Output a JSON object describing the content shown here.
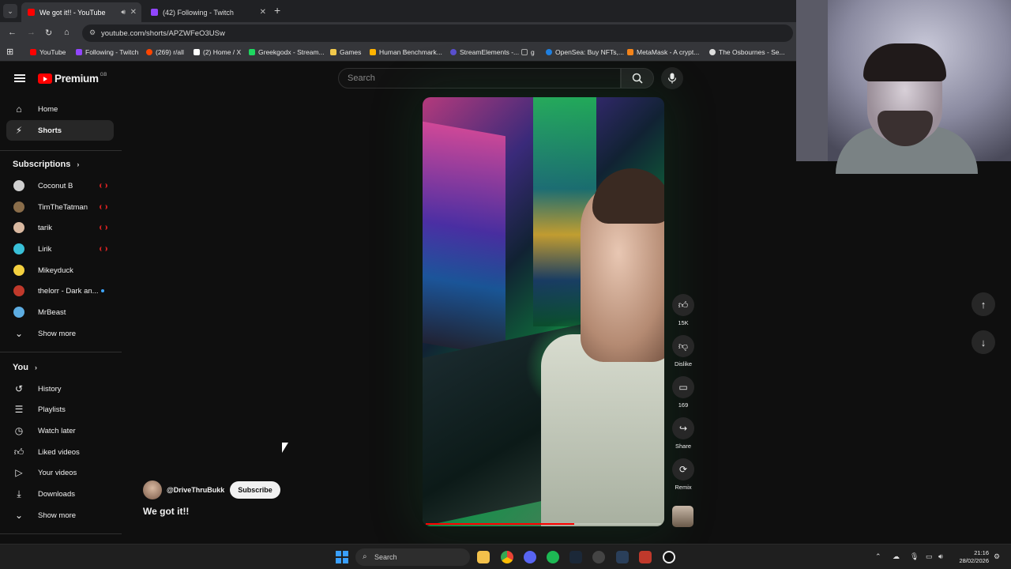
{
  "browser": {
    "tabs": [
      {
        "title": "We got it!! - YouTube",
        "favicon_color": "#ff0000",
        "active": true
      },
      {
        "title": "(42) Following - Twitch",
        "favicon_color": "#9146ff",
        "active": false
      }
    ],
    "url": "youtube.com/shorts/APZWFeO3USw",
    "bookmarks": [
      {
        "label": "YouTube",
        "color": "#ff0000"
      },
      {
        "label": "Following - Twitch",
        "color": "#9146ff"
      },
      {
        "label": "(269) r/all",
        "color": "#ff4500"
      },
      {
        "label": "(2) Home / X",
        "color": "#ffffff"
      },
      {
        "label": "Greekgodx - Stream...",
        "color": "#1ed760"
      },
      {
        "label": "Games",
        "color": "#f2c94c"
      },
      {
        "label": "Human Benchmark...",
        "color": "#ffb300"
      },
      {
        "label": "StreamElements -...",
        "color": "#5a4fcf"
      },
      {
        "label": "g",
        "color": "#aaaaaa"
      },
      {
        "label": "OpenSea: Buy NFTs,...",
        "color": "#2081e2"
      },
      {
        "label": "MetaMask - A crypt...",
        "color": "#f6851b"
      },
      {
        "label": "The Osbournes - Se...",
        "color": "#dddddd"
      }
    ]
  },
  "youtube": {
    "logo_text": "Premium",
    "logo_region": "GB",
    "search_placeholder": "Search",
    "sidebar": {
      "main": [
        {
          "label": "Home",
          "icon": "home-icon",
          "selected": false
        },
        {
          "label": "Shorts",
          "icon": "shorts-icon",
          "selected": true
        }
      ],
      "subscriptions_header": "Subscriptions",
      "subscriptions": [
        {
          "label": "Coconut B",
          "avatar_color": "#cfcfcf",
          "status": "live"
        },
        {
          "label": "TimTheTatman",
          "avatar_color": "#8a6d4a",
          "status": "live"
        },
        {
          "label": "tarik",
          "avatar_color": "#d9b8a0",
          "status": "live"
        },
        {
          "label": "Lirik",
          "avatar_color": "#39c0d8",
          "status": "live"
        },
        {
          "label": "Mikeyduck",
          "avatar_color": "#f4d03f",
          "status": "none"
        },
        {
          "label": "thelorr - Dark an...",
          "avatar_color": "#c0392b",
          "status": "new"
        },
        {
          "label": "MrBeast",
          "avatar_color": "#5dade2",
          "status": "none"
        }
      ],
      "show_more": "Show more",
      "you_header": "You",
      "you_items": [
        {
          "label": "History",
          "icon": "history-icon"
        },
        {
          "label": "Playlists",
          "icon": "playlists-icon"
        },
        {
          "label": "Watch later",
          "icon": "watch-later-icon"
        },
        {
          "label": "Liked videos",
          "icon": "liked-videos-icon"
        },
        {
          "label": "Your videos",
          "icon": "your-videos-icon"
        },
        {
          "label": "Downloads",
          "icon": "downloads-icon"
        }
      ],
      "show_more_2": "Show more"
    },
    "short": {
      "channel_handle": "@DriveThruBukk",
      "subscribe_label": "Subscribe",
      "title": "We got it!!",
      "progress": 0.63,
      "actions": [
        {
          "name": "like",
          "icon": "thumbs-up-icon",
          "label": "15K"
        },
        {
          "name": "dislike",
          "icon": "thumbs-down-icon",
          "label": "Dislike"
        },
        {
          "name": "comments",
          "icon": "comment-icon",
          "label": "169"
        },
        {
          "name": "share",
          "icon": "share-icon",
          "label": "Share"
        },
        {
          "name": "remix",
          "icon": "remix-icon",
          "label": "Remix"
        }
      ]
    }
  },
  "taskbar": {
    "search_label": "Search",
    "time": "21:16",
    "date": "28/02/2026"
  }
}
